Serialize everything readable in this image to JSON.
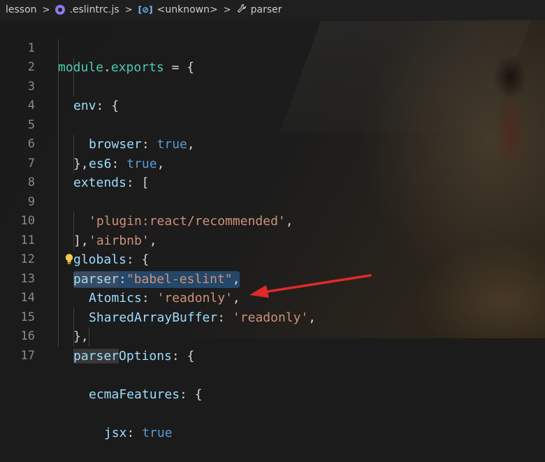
{
  "breadcrumb": {
    "items": [
      {
        "label": "lesson",
        "icon": null
      },
      {
        "label": ".eslintrc.js",
        "icon": "eslint-icon"
      },
      {
        "label": "<unknown>",
        "icon": "variable-icon"
      },
      {
        "label": "parser",
        "icon": "wrench-icon"
      }
    ],
    "separator": ">"
  },
  "lines": [
    {
      "n": "1"
    },
    {
      "n": "2"
    },
    {
      "n": "3"
    },
    {
      "n": "4"
    },
    {
      "n": "5"
    },
    {
      "n": "6"
    },
    {
      "n": "7"
    },
    {
      "n": "8"
    },
    {
      "n": "9"
    },
    {
      "n": "10"
    },
    {
      "n": "11"
    },
    {
      "n": "12"
    },
    {
      "n": "13"
    },
    {
      "n": "14"
    },
    {
      "n": "15"
    },
    {
      "n": "16"
    },
    {
      "n": "17"
    }
  ],
  "code": {
    "l1": {
      "a": "module",
      "b": ".",
      "c": "exports",
      "d": " = {"
    },
    "l2": {
      "a": "env",
      "b": ": {"
    },
    "l3": {
      "a": "browser",
      "b": ": ",
      "c": "true",
      "d": ","
    },
    "l4": {
      "a": "es6",
      "b": ": ",
      "c": "true",
      "d": ","
    },
    "l5": {
      "a": "},"
    },
    "l6": {
      "a": "extends",
      "b": ": ["
    },
    "l7": {
      "a": "'plugin:react/recommended'",
      "b": ","
    },
    "l8": {
      "a": "'airbnb'",
      "b": ","
    },
    "l9": {
      "a": "],"
    },
    "l10": {
      "a": "globals",
      "b": ": {"
    },
    "l11": {
      "a": "Atomics",
      "b": ": ",
      "c": "'readonly'",
      "d": ","
    },
    "l12": {
      "a": "SharedArrayBuffer",
      "b": ": ",
      "c": "'readonly'",
      "d": ","
    },
    "l13": {
      "a": "},"
    },
    "l14": {
      "a": "parser",
      "b": ":",
      "c": "\"babel-eslint\"",
      "d": ","
    },
    "l15": {
      "a": "parser",
      "a2": "Options",
      "b": ": {"
    },
    "l16": {
      "a": "ecmaFeatures",
      "b": ": {"
    },
    "l17": {
      "a": "jsx",
      "b": ": ",
      "c": "true"
    }
  },
  "colors": {
    "selection": "#264f78",
    "annotation_arrow": "#e0292b",
    "lightbulb": "#f2c94c"
  }
}
